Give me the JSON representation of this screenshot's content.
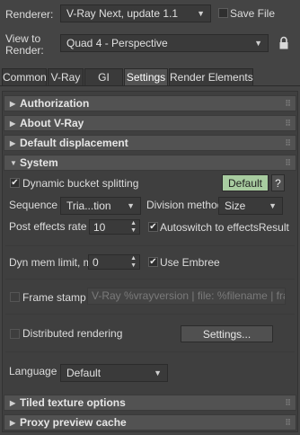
{
  "header": {
    "renderer_label": "Renderer:",
    "renderer_value": "V-Ray Next, update 1.1",
    "save_file_label": "Save File",
    "view_to_render_label": "View to\nRender:",
    "view_value": "Quad 4 - Perspective",
    "lock_icon": "lock-icon"
  },
  "tabs": [
    {
      "label": "Common",
      "active": false
    },
    {
      "label": "V-Ray",
      "active": false
    },
    {
      "label": "GI",
      "active": false
    },
    {
      "label": "Settings",
      "active": true
    },
    {
      "label": "Render Elements",
      "active": false
    }
  ],
  "rollouts": {
    "authorization": "Authorization",
    "about": "About V-Ray",
    "default_displacement": "Default displacement",
    "system": "System",
    "tiled_texture": "Tiled texture options",
    "proxy_preview": "Proxy preview cache"
  },
  "system": {
    "dynamic_bucket_label": "Dynamic bucket splitting",
    "dynamic_bucket_checked": true,
    "default_button": "Default",
    "help_button": "?",
    "sequence_label": "Sequence",
    "sequence_value": "Tria...tion",
    "division_label": "Division method",
    "division_value": "Size",
    "post_effects_label": "Post effects rate",
    "post_effects_value": "10",
    "autoswitch_label": "Autoswitch to effectsResult",
    "autoswitch_checked": true,
    "dyn_mem_label": "Dyn mem limit, mb",
    "dyn_mem_value": "0",
    "use_embree_label": "Use Embree",
    "use_embree_checked": true,
    "frame_stamp_label": "Frame stamp",
    "frame_stamp_checked": false,
    "frame_stamp_value": "V-Ray %vrayversion | file: %filename | fram",
    "distributed_label": "Distributed rendering",
    "distributed_checked": false,
    "settings_button": "Settings...",
    "language_label": "Language",
    "language_value": "Default"
  },
  "colors": {
    "background": "#444444",
    "rollout_header": "#525252",
    "default_button_bg": "#a8cca0"
  }
}
